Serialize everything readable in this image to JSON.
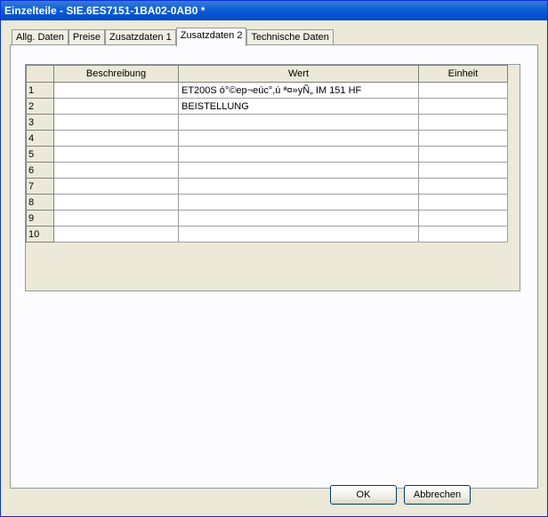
{
  "window": {
    "title": "Einzelteile - SIE.6ES7151-1BA02-0AB0 *"
  },
  "tabs": [
    {
      "label": "Allg. Daten",
      "active": false
    },
    {
      "label": "Preise",
      "active": false
    },
    {
      "label": "Zusatzdaten 1",
      "active": false
    },
    {
      "label": "Zusatzdaten 2",
      "active": true
    },
    {
      "label": "Technische Daten",
      "active": false
    }
  ],
  "grid": {
    "columns": [
      "",
      "Beschreibung",
      "Wert",
      "Einheit"
    ],
    "rows": [
      {
        "num": "1",
        "beschreibung": "",
        "wert": "ET200S ó°©ep¬eúc°,ú ª¤»yÑ„ IM 151 HF",
        "einheit": ""
      },
      {
        "num": "2",
        "beschreibung": "",
        "wert": "BEISTELLUNG",
        "einheit": ""
      },
      {
        "num": "3",
        "beschreibung": "",
        "wert": "",
        "einheit": ""
      },
      {
        "num": "4",
        "beschreibung": "",
        "wert": "",
        "einheit": ""
      },
      {
        "num": "5",
        "beschreibung": "",
        "wert": "",
        "einheit": ""
      },
      {
        "num": "6",
        "beschreibung": "",
        "wert": "",
        "einheit": ""
      },
      {
        "num": "7",
        "beschreibung": "",
        "wert": "",
        "einheit": ""
      },
      {
        "num": "8",
        "beschreibung": "",
        "wert": "",
        "einheit": ""
      },
      {
        "num": "9",
        "beschreibung": "",
        "wert": "",
        "einheit": ""
      },
      {
        "num": "10",
        "beschreibung": "",
        "wert": "",
        "einheit": ""
      }
    ]
  },
  "buttons": {
    "ok": "OK",
    "cancel": "Abbrechen"
  }
}
